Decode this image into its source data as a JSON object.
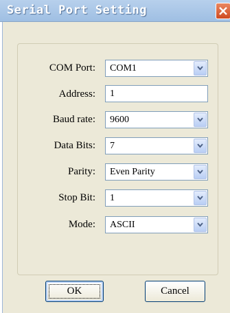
{
  "window": {
    "title": "Serial Port Setting"
  },
  "fields": {
    "com_port": {
      "label": "COM Port:",
      "value": "COM1"
    },
    "address": {
      "label": "Address:",
      "value": "1"
    },
    "baud_rate": {
      "label": "Baud rate:",
      "value": "9600"
    },
    "data_bits": {
      "label": "Data Bits:",
      "value": "7"
    },
    "parity": {
      "label": "Parity:",
      "value": "Even Parity"
    },
    "stop_bit": {
      "label": "Stop Bit:",
      "value": "1"
    },
    "mode": {
      "label": "Mode:",
      "value": "ASCII"
    }
  },
  "buttons": {
    "ok_label": "OK",
    "cancel_label": "Cancel"
  },
  "icons": {
    "close": "close-icon",
    "dropdown": "chevron-down-icon"
  },
  "colors": {
    "titlebar": "#9fbfe3",
    "close_button": "#cf4b22",
    "dialog_body": "#ece9d8",
    "field_border": "#7f9db9"
  }
}
